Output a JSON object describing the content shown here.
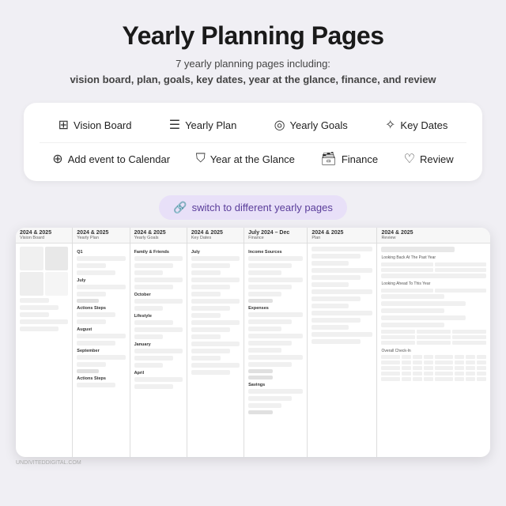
{
  "page": {
    "title": "Yearly Planning Pages",
    "subtitle_line1": "7 yearly planning pages including:",
    "subtitle_line2": "vision board, plan, goals, key dates, year at the glance, finance, and review"
  },
  "features": {
    "row1": [
      {
        "id": "vision-board",
        "label": "Vision Board",
        "icon": "⊞"
      },
      {
        "id": "yearly-plan",
        "label": "Yearly Plan",
        "icon": "📋"
      },
      {
        "id": "yearly-goals",
        "label": "Yearly Goals",
        "icon": "◎"
      },
      {
        "id": "key-dates",
        "label": "Key Dates",
        "icon": "✦"
      }
    ],
    "row2": [
      {
        "id": "add-calendar",
        "label": "Add event to Calendar",
        "icon": "⊕"
      },
      {
        "id": "year-glance",
        "label": "Year at the Glance",
        "icon": "🔖"
      },
      {
        "id": "finance",
        "label": "Finance",
        "icon": "🗄"
      },
      {
        "id": "review",
        "label": "Review",
        "icon": "♡"
      }
    ]
  },
  "switch_button": {
    "label": "switch to different yearly pages",
    "icon": "🔗"
  },
  "preview_panels": [
    {
      "id": "vision-board-panel",
      "year": "2024 & 2025",
      "name": "Vision Board"
    },
    {
      "id": "yearly-plan-panel",
      "year": "2024 & 2025",
      "name": "Yearly Plan"
    },
    {
      "id": "yearly-goals-panel",
      "year": "2024 & 2025",
      "name": "Yearly Goals"
    },
    {
      "id": "key-dates-panel",
      "year": "2024 & 2025",
      "name": "Key Dates"
    },
    {
      "id": "finance-panel",
      "year": "July 2024 – Dec",
      "name": "Finance"
    },
    {
      "id": "another-plan-panel",
      "year": "2024 & 2025",
      "name": "Plan"
    },
    {
      "id": "review-panel",
      "year": "2024 & 2025",
      "name": "Review"
    }
  ],
  "watermark": "UNDIVITEDDIGITAL.COM"
}
